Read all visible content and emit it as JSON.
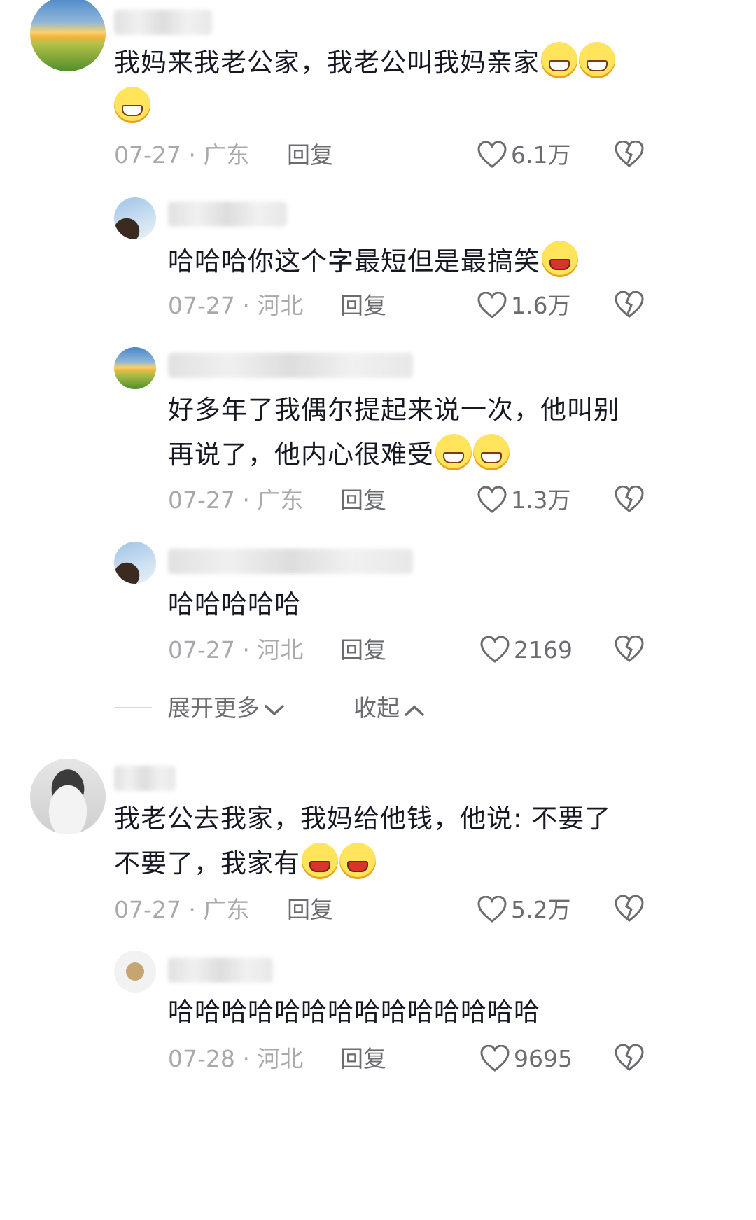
{
  "comments": [
    {
      "text_lines": [
        "我妈来我老公家，我老公叫我妈亲家",
        ""
      ],
      "emojis_line1": 2,
      "emojis_line2": 1,
      "date": "07-27",
      "region": "广东",
      "reply_label": "回复",
      "likes": "6.1万",
      "avatar": "sunset"
    },
    {
      "text_lines": [
        "哈哈哈你这个字最短但是最搞笑"
      ],
      "date": "07-27",
      "region": "河北",
      "reply_label": "回复",
      "likes": "1.6万",
      "avatar": "sky"
    },
    {
      "text_lines": [
        "好多年了我偶尔提起来说一次，他叫别",
        "再说了，他内心很难受"
      ],
      "date": "07-27",
      "region": "广东",
      "reply_label": "回复",
      "likes": "1.3万",
      "avatar": "sunset"
    },
    {
      "text_lines": [
        "哈哈哈哈哈"
      ],
      "date": "07-27",
      "region": "河北",
      "reply_label": "回复",
      "likes": "2169",
      "avatar": "sky"
    },
    {
      "text_lines": [
        "我老公去我家，我妈给他钱，他说: 不要了",
        "不要了，我家有"
      ],
      "date": "07-27",
      "region": "广东",
      "reply_label": "回复",
      "likes": "5.2万",
      "avatar": "cat"
    },
    {
      "text_lines": [
        "哈哈哈哈哈哈哈哈哈哈哈哈哈哈"
      ],
      "date": "07-28",
      "region": "河北",
      "reply_label": "回复",
      "likes": "9695",
      "avatar": "box"
    }
  ],
  "thread_controls": {
    "expand_label": "展开更多",
    "collapse_label": "收起"
  },
  "icons": [
    "heart-icon",
    "dislike-icon",
    "chevron-down-icon",
    "chevron-up-icon",
    "emoji-icon"
  ],
  "colors": {
    "text": "#161823",
    "meta": "#a8a9ad",
    "action": "#6b6c70"
  }
}
